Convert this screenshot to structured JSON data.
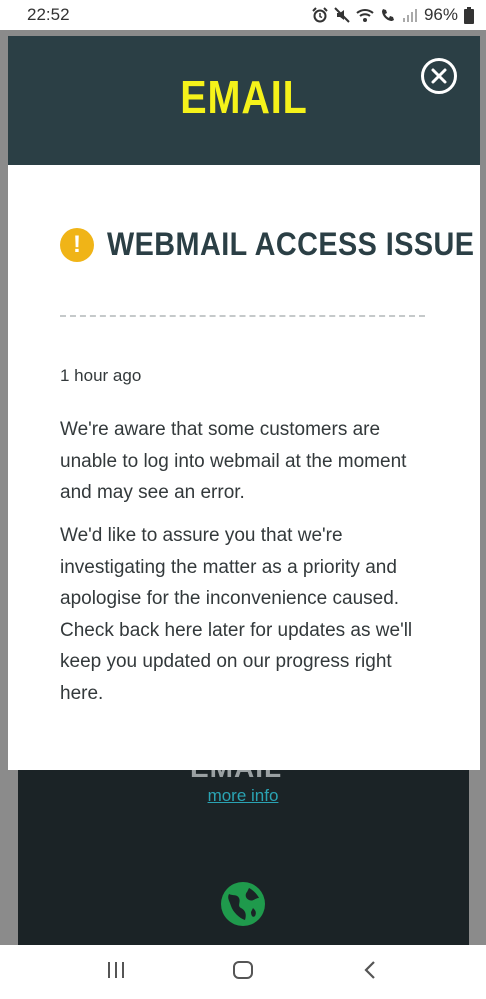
{
  "status_bar": {
    "time": "22:52",
    "battery": "96%",
    "icons": [
      "alarm-icon",
      "mute-icon",
      "wifi-icon",
      "wifi-calling-icon",
      "signal-icon",
      "battery-icon"
    ]
  },
  "modal": {
    "title": "EMAIL",
    "alert_title": "WEBMAIL ACCESS ISSUE",
    "alert_icon": "!",
    "timestamp": "1 hour ago",
    "paragraphs": [
      "We're aware that some customers are unable to log into webmail at the moment and may see an error.",
      "We'd like to assure you that we're investigating the matter as a priority and apologise for the inconvenience caused. Check back here later for updates as we'll keep you updated on our progress right here."
    ]
  },
  "background": {
    "email_label": "EMAIL",
    "more_info": "more info"
  },
  "colors": {
    "header": "#2b3f45",
    "title": "#f5f21a",
    "alert": "#f0b417",
    "link": "#2aa3b3",
    "globe": "#1f9a4c"
  },
  "nav": {
    "icons": [
      "recent-apps-icon",
      "home-icon",
      "back-icon"
    ]
  }
}
